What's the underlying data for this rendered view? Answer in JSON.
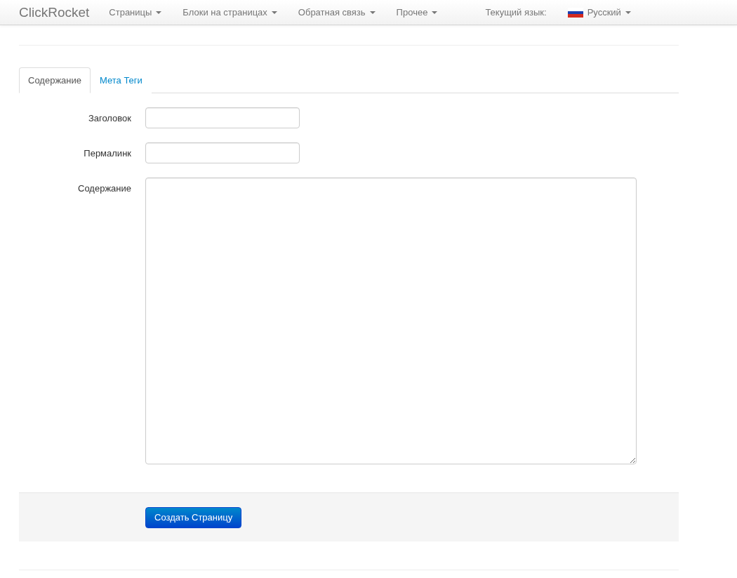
{
  "navbar": {
    "brand": "ClickRocket",
    "menus": [
      {
        "label": "Страницы"
      },
      {
        "label": "Блоки на страницах"
      },
      {
        "label": "Обратная связь"
      },
      {
        "label": "Прочее"
      }
    ],
    "language_label": "Текущий язык:",
    "language": "Русский"
  },
  "tabs": [
    {
      "label": "Содержание",
      "selected": true
    },
    {
      "label": "Мета Теги",
      "selected": false
    }
  ],
  "fields": [
    {
      "label": "Заголовок",
      "kind": "input"
    },
    {
      "label": "Пермалинк",
      "kind": "input"
    },
    {
      "label": "Содержание",
      "kind": "textarea"
    }
  ],
  "submit": "Создать Страницу"
}
